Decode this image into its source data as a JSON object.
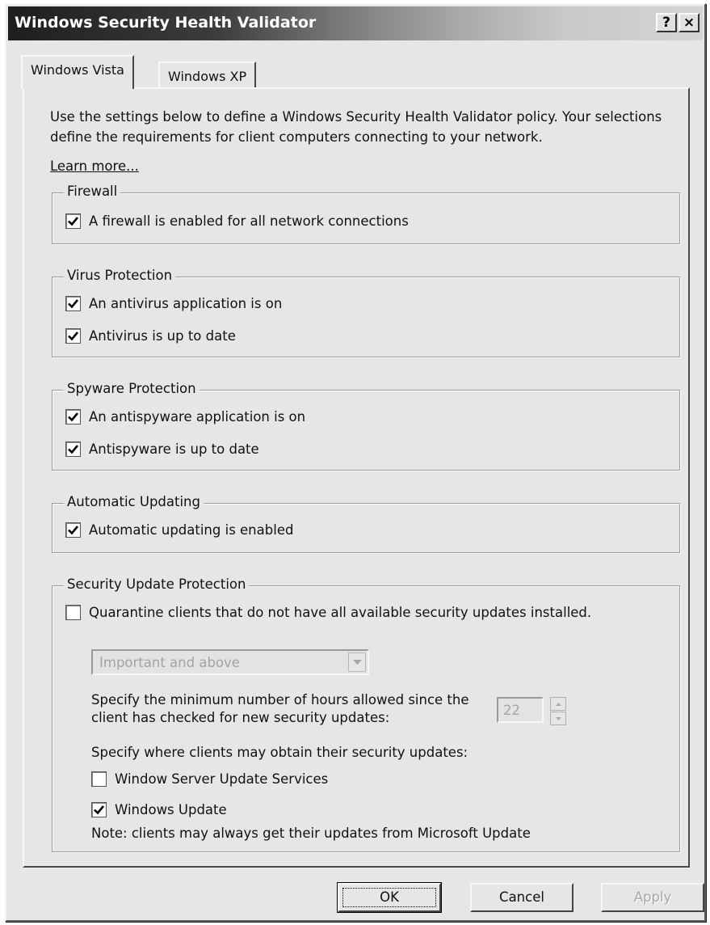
{
  "window": {
    "title": "Windows Security Health Validator",
    "help_button": "?",
    "close_button": "×"
  },
  "tabs": [
    {
      "label": "Windows Vista",
      "active": true
    },
    {
      "label": "Windows XP",
      "active": false
    }
  ],
  "intro": {
    "text": "Use the settings below to define a Windows Security Health Validator policy. Your selections define the requirements for client computers connecting to your network.",
    "learn_more": "Learn more..."
  },
  "groups": {
    "firewall": {
      "label": "Firewall",
      "items": [
        {
          "label": "A firewall is enabled for all network connections",
          "checked": true
        }
      ]
    },
    "virus": {
      "label": "Virus Protection",
      "items": [
        {
          "label": "An antivirus application is on",
          "checked": true
        },
        {
          "label": "Antivirus is up to date",
          "checked": true
        }
      ]
    },
    "spyware": {
      "label": "Spyware Protection",
      "items": [
        {
          "label": "An antispyware application is on",
          "checked": true
        },
        {
          "label": "Antispyware is up to date",
          "checked": true
        }
      ]
    },
    "updating": {
      "label": "Automatic Updating",
      "items": [
        {
          "label": "Automatic updating is enabled",
          "checked": true
        }
      ]
    },
    "security_update": {
      "label": "Security Update Protection",
      "quarantine": {
        "label": "Quarantine clients that do not have all available security updates installed.",
        "checked": false
      },
      "severity_dropdown": {
        "value": "Important and above"
      },
      "hours_label": "Specify the minimum number of hours allowed since the client has checked for new security updates:",
      "hours_value": "22",
      "sources_label": "Specify where clients may obtain their security updates:",
      "sources": [
        {
          "label": "Window Server Update Services",
          "checked": false
        },
        {
          "label": "Windows Update",
          "checked": true
        }
      ],
      "note": "Note: clients may always get their updates from Microsoft Update"
    }
  },
  "buttons": {
    "ok": "OK",
    "cancel": "Cancel",
    "apply": "Apply"
  },
  "icons": {
    "checkmark": "check-icon",
    "dropdown_arrow": "chevron-down-icon",
    "spin_up": "spin-up-icon",
    "spin_down": "spin-down-icon"
  }
}
